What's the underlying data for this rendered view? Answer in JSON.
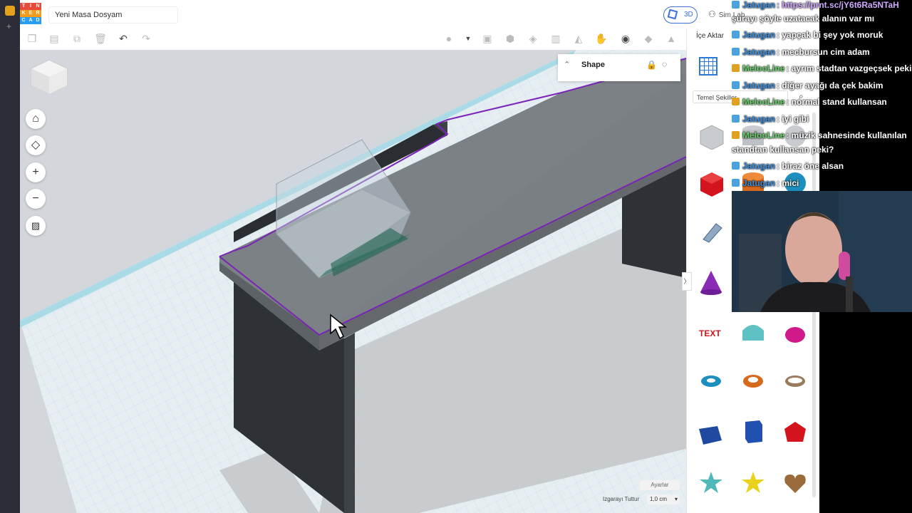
{
  "app": {
    "logo": [
      "T",
      "I",
      "N",
      "K",
      "E",
      "R",
      "C",
      "A",
      "D"
    ],
    "document_title": "Yeni Masa Dosyam",
    "view_3d_label": "3D",
    "sim_lab_label": "Sim Lab"
  },
  "viewport": {
    "shape_panel_title": "Shape",
    "settings_label": "Ayarlar",
    "grid_snap_label": "Izgarayı Tuttur",
    "grid_snap_value": "1,0 cm"
  },
  "right_panel": {
    "import_label": "İçe Aktar",
    "category_label": "Temel Şekiller",
    "shapes": [
      "box-hole",
      "box",
      "cylinder",
      "sphere",
      "scribble",
      "pyramid",
      "cone",
      "roof",
      "text",
      "round-roof",
      "paraboloid",
      "torus",
      "tube",
      "ring",
      "wedge",
      "polygon",
      "icosahedron",
      "star",
      "star-solid",
      "heart"
    ]
  },
  "chat": [
    {
      "user": "Jatugan",
      "user_color": "#3a8fe0",
      "badge_color": "#4aa3df",
      "text": ": https://prnt.sc/jY6t6Ra5NTaH",
      "text_color": "#cfa7ff"
    },
    {
      "user": "",
      "user_color": "#ffffff",
      "badge_color": "",
      "text": "şurayı şöyle uzatacak alanın var mı",
      "text_color": "#ffffff"
    },
    {
      "user": "Jatugan",
      "user_color": "#3a8fe0",
      "badge_color": "#4aa3df",
      "text": ": yapçak bi şey yok moruk",
      "text_color": "#ffffff"
    },
    {
      "user": "Jatugan",
      "user_color": "#3a8fe0",
      "badge_color": "#4aa3df",
      "text": ": mecbursun cim adam",
      "text_color": "#ffffff"
    },
    {
      "user": "MelooLine",
      "user_color": "#6cd36c",
      "badge_color": "#e0a020",
      "text": ": ayrım stadtan vazgeçsek peki",
      "text_color": "#ffffff"
    },
    {
      "user": "Jatugan",
      "user_color": "#3a8fe0",
      "badge_color": "#4aa3df",
      "text": ": diğer ayağı da çek bakim",
      "text_color": "#ffffff"
    },
    {
      "user": "MelooLine",
      "user_color": "#6cd36c",
      "badge_color": "#e0a020",
      "text": ": normal stand kullansan",
      "text_color": "#ffffff"
    },
    {
      "user": "Jatugan",
      "user_color": "#3a8fe0",
      "badge_color": "#4aa3df",
      "text": ": iyi gibi",
      "text_color": "#ffffff"
    },
    {
      "user": "MelooLine",
      "user_color": "#6cd36c",
      "badge_color": "#e0a020",
      "text": ": müzik sahnesinde kullanılan",
      "text_color": "#ffffff"
    },
    {
      "user": "",
      "user_color": "#ffffff",
      "badge_color": "",
      "text": "standtan kullansan peki?",
      "text_color": "#ffffff"
    },
    {
      "user": "Jatugan",
      "user_color": "#3a8fe0",
      "badge_color": "#4aa3df",
      "text": ": biraz öne alsan",
      "text_color": "#ffffff"
    },
    {
      "user": "Jatugan",
      "user_color": "#3a8fe0",
      "badge_color": "#4aa3df",
      "text": ": mici",
      "text_color": "#ffffff"
    }
  ]
}
